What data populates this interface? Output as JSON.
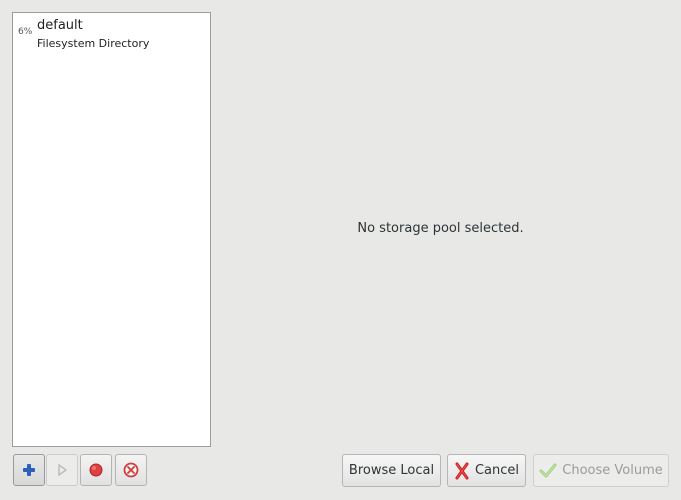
{
  "storage_pools": [
    {
      "usage": "6%",
      "name": "default",
      "type": "Filesystem Directory"
    }
  ],
  "main": {
    "empty_message": "No storage pool selected."
  },
  "toolbar": {
    "add_icon": "plus-icon",
    "start_icon": "play-icon",
    "stop_icon": "stop-icon",
    "delete_icon": "delete-icon"
  },
  "buttons": {
    "browse_local": "Browse Local",
    "cancel": "Cancel",
    "choose_volume": "Choose Volume"
  },
  "colors": {
    "accent_blue": "#2f5fbc",
    "cancel_red": "#cc1f1f",
    "stop_red": "#e04141",
    "disabled_gray": "#9b9b9b",
    "success_green": "#78b84a"
  }
}
